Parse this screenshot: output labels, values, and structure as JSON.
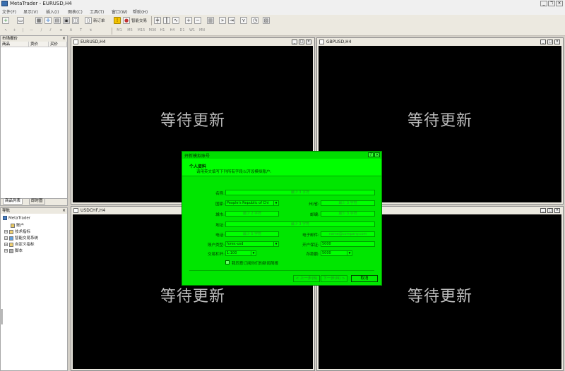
{
  "window": {
    "title": "MetaTrader - EURUSD,H4",
    "controls": [
      "_",
      "ℸ",
      "×"
    ]
  },
  "menu": [
    "文件(F)",
    "显示(V)",
    "插入(I)",
    "图表(C)",
    "工具(T)",
    "窗口(W)",
    "帮助(H)"
  ],
  "toolbar": {
    "new_order_label": "新订单",
    "auto_trading_label": "智能交易"
  },
  "toolbar2": {
    "timeframes": [
      "M1",
      "M5",
      "M15",
      "M30",
      "H1",
      "H4",
      "D1",
      "W1",
      "MN"
    ]
  },
  "market_watch": {
    "title": "市场报价",
    "columns": [
      "商品",
      "卖价",
      "买价"
    ],
    "tabs": [
      "商品列表",
      "即时图"
    ]
  },
  "navigator": {
    "title": "导航",
    "root": "MetaTrader",
    "items": [
      "账户",
      "技术指标",
      "智能交易系统",
      "自定义指标",
      "脚本"
    ]
  },
  "charts": [
    {
      "name": "EURUSD,H4",
      "status": "等待更新"
    },
    {
      "name": "GBPUSD,H4",
      "status": "等待更新"
    },
    {
      "name": "USDCHF,H4",
      "status": "等待更新"
    },
    {
      "name": "",
      "status": "等待更新"
    }
  ],
  "dialog": {
    "title": "开新模拟账号",
    "heading": "个人资料",
    "subheading": "请用英文填写下列所有字段以开设模拟账户:",
    "fields": {
      "name": {
        "label": "名称:",
        "placeholder": "最少 3 字符"
      },
      "country": {
        "label": "国家:",
        "value": "People's Republic of Chi"
      },
      "state": {
        "label": "州/省:",
        "placeholder": "最少 3 字符"
      },
      "city": {
        "label": "城市:",
        "placeholder": "最少 2 字符"
      },
      "zip": {
        "label": "邮编:",
        "placeholder": "最少 3 字符"
      },
      "address": {
        "label": "地址:",
        "placeholder": "最少 3 字符"
      },
      "phone": {
        "label": "电话:",
        "placeholder": "最少 5 字符"
      },
      "email": {
        "label": "电子邮件:",
        "placeholder": "name@company.com"
      },
      "account_type": {
        "label": "账户类型:",
        "value": "forex-usd"
      },
      "deposit": {
        "label": "开户保证:",
        "value": "5000"
      },
      "leverage": {
        "label": "交易杠杆:",
        "value": "1:100"
      },
      "amount": {
        "label": "存款额:",
        "value": "5000"
      }
    },
    "checkbox_label": "我同意订阅你们的新闻简报",
    "buttons": {
      "back": "< 上一步(B)",
      "next": "下一步(N) >",
      "cancel": "取消"
    }
  }
}
